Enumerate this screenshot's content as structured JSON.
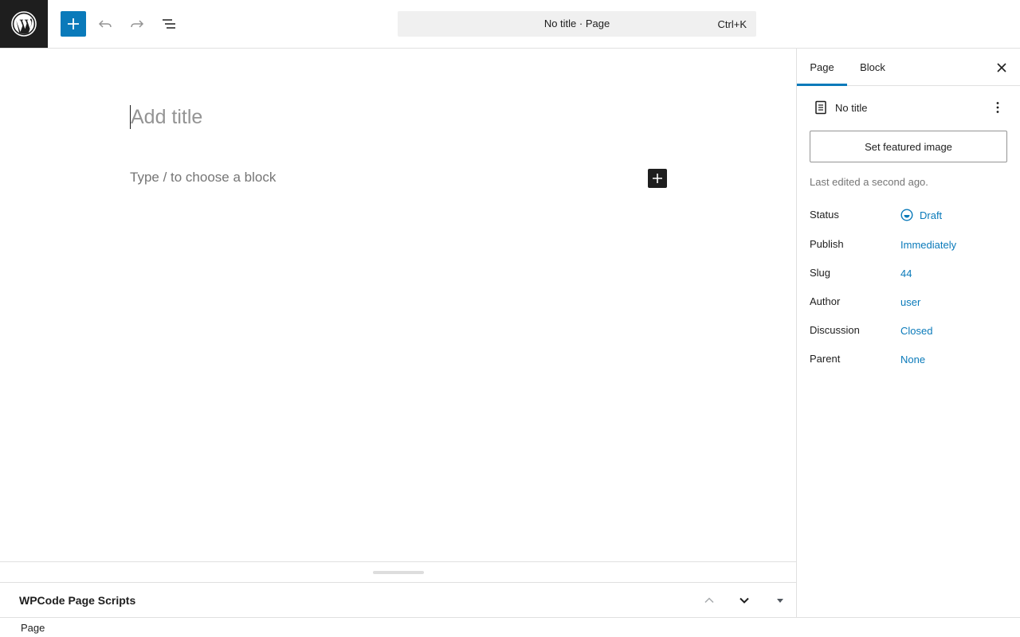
{
  "toolbar": {
    "command_title": "No title · Page",
    "command_shortcut": "Ctrl+K"
  },
  "editor": {
    "title_placeholder": "Add title",
    "block_placeholder": "Type / to choose a block"
  },
  "metabox": {
    "title": "WPCode Page Scripts"
  },
  "footer": {
    "breadcrumb": "Page"
  },
  "sidebar": {
    "tabs": [
      {
        "label": "Page",
        "active": true
      },
      {
        "label": "Block",
        "active": false
      }
    ],
    "post_title": "No title",
    "featured_image_label": "Set featured image",
    "last_edited": "Last edited a second ago.",
    "meta": [
      {
        "label": "Status",
        "value": "Draft"
      },
      {
        "label": "Publish",
        "value": "Immediately"
      },
      {
        "label": "Slug",
        "value": "44"
      },
      {
        "label": "Author",
        "value": "user"
      },
      {
        "label": "Discussion",
        "value": "Closed"
      },
      {
        "label": "Parent",
        "value": "None"
      }
    ]
  },
  "colors": {
    "accent": "#0a7aba",
    "dark": "#1e1e1e",
    "border": "#e0e0e0"
  },
  "icons": [
    "wordpress-logo-icon",
    "plus-icon",
    "undo-icon",
    "redo-icon",
    "list-view-icon",
    "close-icon",
    "page-icon",
    "more-vertical-icon",
    "draft-status-icon",
    "chevron-up-icon",
    "chevron-down-icon",
    "caret-down-icon"
  ]
}
